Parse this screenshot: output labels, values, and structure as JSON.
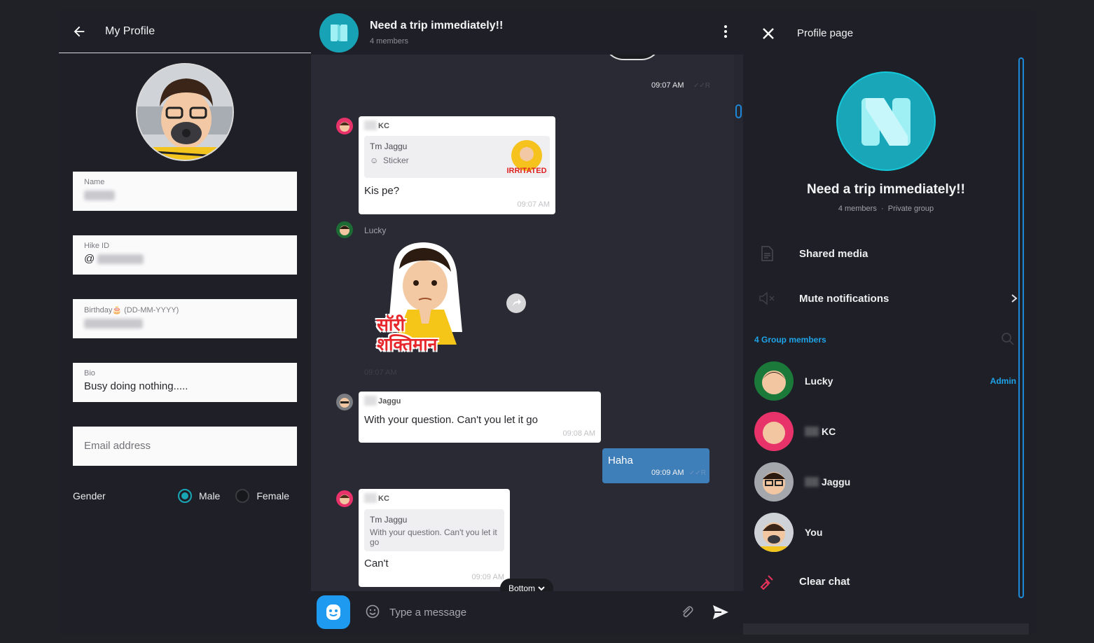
{
  "left_panel": {
    "title": "My Profile",
    "fields": {
      "name": {
        "label": "Name",
        "value": ""
      },
      "hike_id": {
        "label": "Hike ID",
        "prefix": "@",
        "value": ""
      },
      "birthday": {
        "label": "Birthday🎂 (DD-MM-YYYY)",
        "value": ""
      },
      "bio": {
        "label": "Bio",
        "value": "Busy doing nothing....."
      },
      "email": {
        "placeholder": "Email address"
      }
    },
    "gender": {
      "label": "Gender",
      "options": [
        "Male",
        "Female"
      ],
      "selected": "Male"
    }
  },
  "chat": {
    "title": "Need a trip immediately!!",
    "members": "4 members",
    "messages": [
      {
        "type": "time_only",
        "time": "09:07 AM",
        "status": "R"
      },
      {
        "sender": "KC",
        "reply_to": {
          "name": "Tm Jaggu",
          "text": "Sticker"
        },
        "sticker_label": "IRRITATED",
        "text": "Kis pe?",
        "time": "09:07 AM"
      },
      {
        "sender": "Lucky",
        "sticker_text": "सॉरी शक्तिमान",
        "time": "09:07 AM"
      },
      {
        "sender": "Jaggu",
        "text": "With your question. Can't you let it go",
        "time": "09:08 AM"
      },
      {
        "sender": "You",
        "text": "Haha",
        "time": "09:09 AM",
        "status": "R"
      },
      {
        "sender": "KC",
        "reply_to": {
          "name": "Tm Jaggu",
          "text": "With your question. Can't you let it go"
        },
        "text": "Can't",
        "time": "09:09 AM"
      }
    ],
    "bottom_button": "Bottom",
    "composer_placeholder": "Type a message"
  },
  "right_panel": {
    "title": "Profile page",
    "group_name": "Need a trip immediately!!",
    "members_count": "4 members",
    "group_type": "Private group",
    "actions": {
      "shared_media": "Shared media",
      "mute": "Mute notifications",
      "clear": "Clear chat"
    },
    "members_label": "4 Group members",
    "members": [
      {
        "name": "Lucky",
        "role": "Admin"
      },
      {
        "name": "KC",
        "role": ""
      },
      {
        "name": "Jaggu",
        "role": ""
      },
      {
        "name": "You",
        "role": ""
      }
    ]
  },
  "colors": {
    "accent": "#1ea3e8",
    "teal": "#19a6b8",
    "outgoing_bubble": "#3e7eb9",
    "danger": "#e8335c"
  },
  "icons": [
    "back-arrow-icon",
    "kebab-menu-icon",
    "forward-icon",
    "emoji-icon",
    "attach-icon",
    "send-icon",
    "close-icon",
    "file-icon",
    "mute-icon",
    "chevron-right-icon",
    "search-icon",
    "broom-icon"
  ]
}
